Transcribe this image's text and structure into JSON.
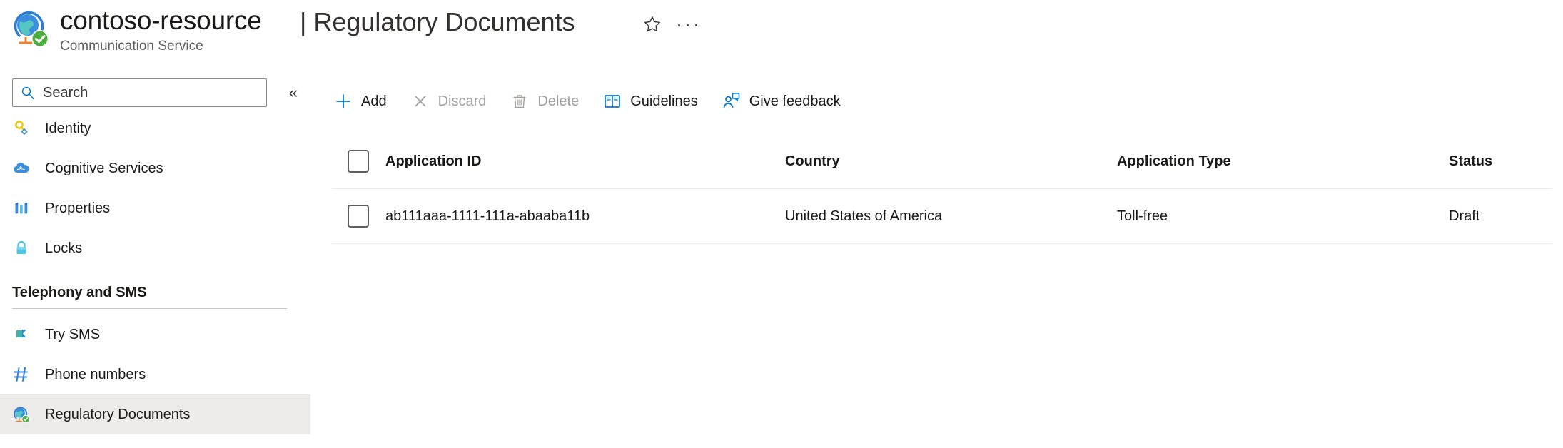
{
  "header": {
    "resource_icon": "globe-check-icon",
    "resource_name": "contoso-resource",
    "resource_subtitle": "Communication Service",
    "separator": "|",
    "page_title": "Regulatory Documents",
    "favorite_icon": "star-icon",
    "more_icon": "ellipsis-icon",
    "more_label": "···"
  },
  "sidebar": {
    "search": {
      "placeholder": "Search",
      "value": "",
      "icon": "search-icon"
    },
    "collapse": {
      "icon": "chevron-double-left-icon",
      "glyph": "«"
    },
    "items": [
      {
        "label": "Identity",
        "icon": "key-icon",
        "selected": false
      },
      {
        "label": "Cognitive Services",
        "icon": "cloud-ai-icon",
        "selected": false
      },
      {
        "label": "Properties",
        "icon": "bars-icon",
        "selected": false
      },
      {
        "label": "Locks",
        "icon": "lock-icon",
        "selected": false
      }
    ],
    "group": {
      "title": "Telephony and SMS",
      "items": [
        {
          "label": "Try SMS",
          "icon": "flag-icon",
          "selected": false
        },
        {
          "label": "Phone numbers",
          "icon": "hash-icon",
          "selected": false
        },
        {
          "label": "Regulatory Documents",
          "icon": "globe-check-icon",
          "selected": true
        }
      ]
    }
  },
  "toolbar": {
    "buttons": [
      {
        "label": "Add",
        "icon": "plus-icon",
        "disabled": false
      },
      {
        "label": "Discard",
        "icon": "cross-icon",
        "disabled": true
      },
      {
        "label": "Delete",
        "icon": "trash-icon",
        "disabled": true
      },
      {
        "label": "Guidelines",
        "icon": "book-icon",
        "disabled": false
      },
      {
        "label": "Give feedback",
        "icon": "feedback-icon",
        "disabled": false
      }
    ]
  },
  "table": {
    "select_all_checkbox": "unchecked",
    "columns": [
      "Application ID",
      "Country",
      "Application Type",
      "Status"
    ],
    "rows": [
      {
        "checkbox": "unchecked",
        "application_id": "ab111aaa-1111-111a-abaaba11b",
        "country": "United States of America",
        "application_type": "Toll-free",
        "status": "Draft"
      }
    ]
  },
  "colors": {
    "accent": "#0078d4",
    "text": "#1b1a19",
    "muted": "#605e5c",
    "disabled": "#a19f9d",
    "selected_bg": "#edebe9",
    "divider": "#edebe9"
  }
}
